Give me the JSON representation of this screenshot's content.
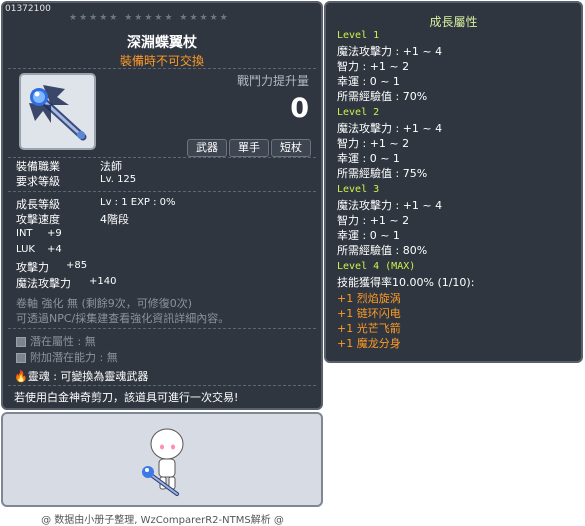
{
  "item": {
    "id": "01372100",
    "stars": "★★★★★  ★★★★★  ★★★★★",
    "name": "深淵蝶翼杖",
    "untradable": "裝備時不可交換",
    "power_label": "戰鬥力提升量",
    "power_value": "0",
    "tags": [
      "武器",
      "單手",
      "短杖"
    ],
    "job_label": "裝備職業",
    "job_value": "法師",
    "req_level_label": "要求等級",
    "req_level_value": "Lv. 125",
    "growth_label": "成長等級",
    "growth_value": "Lv : 1   EXP : 0%",
    "speed_label": "攻擊速度",
    "speed_value": "4階段",
    "stats": [
      {
        "label": "INT",
        "value": "+9"
      },
      {
        "label": "LUK",
        "value": "+4"
      },
      {
        "label": "攻擊力",
        "value": "+85"
      },
      {
        "label": "魔法攻擊力",
        "value": "+140"
      }
    ],
    "scroll_line": "卷軸 強化 無 (剩餘9次，可修復0次)",
    "hint_line": "可透過NPC/採集建查看強化資訊詳細內容。",
    "potential_label": "潛在屬性",
    "potential_value": "無",
    "bonus_potential_label": "附加潛在能力",
    "bonus_potential_value": "無",
    "soul_label": "靈魂",
    "soul_value": "可變換為靈魂武器",
    "platinum_note": "若使用白金神奇剪刀，該道具可進行一次交易!"
  },
  "growth": {
    "title": "成長屬性",
    "levels": [
      {
        "level": "Level 1",
        "lines": [
          "魔法攻擊力 : +1 ~ 4",
          "智力 : +1 ~ 2",
          "幸運 : 0 ~ 1",
          "所需經驗值 : 70%"
        ]
      },
      {
        "level": "Level 2",
        "lines": [
          "魔法攻擊力 : +1 ~ 4",
          "智力 : +1 ~ 2",
          "幸運 : 0 ~ 1",
          "所需經驗值 : 75%"
        ]
      },
      {
        "level": "Level 3",
        "lines": [
          "魔法攻擊力 : +1 ~ 4",
          "智力 : +1 ~ 2",
          "幸運 : 0 ~ 1",
          "所需經驗值 : 80%"
        ]
      },
      {
        "level": "Level 4 (MAX)",
        "lines": [
          "技能獲得率10.00% (1/10):"
        ]
      }
    ],
    "skills": [
      "+1 烈焰旋涡",
      "+1 链环闪电",
      "+1 光芒飞箭",
      "+1 魔龙分身"
    ]
  },
  "footer": "@ 数据由小册子整理, WzComparerR2-NTMS解析 @"
}
